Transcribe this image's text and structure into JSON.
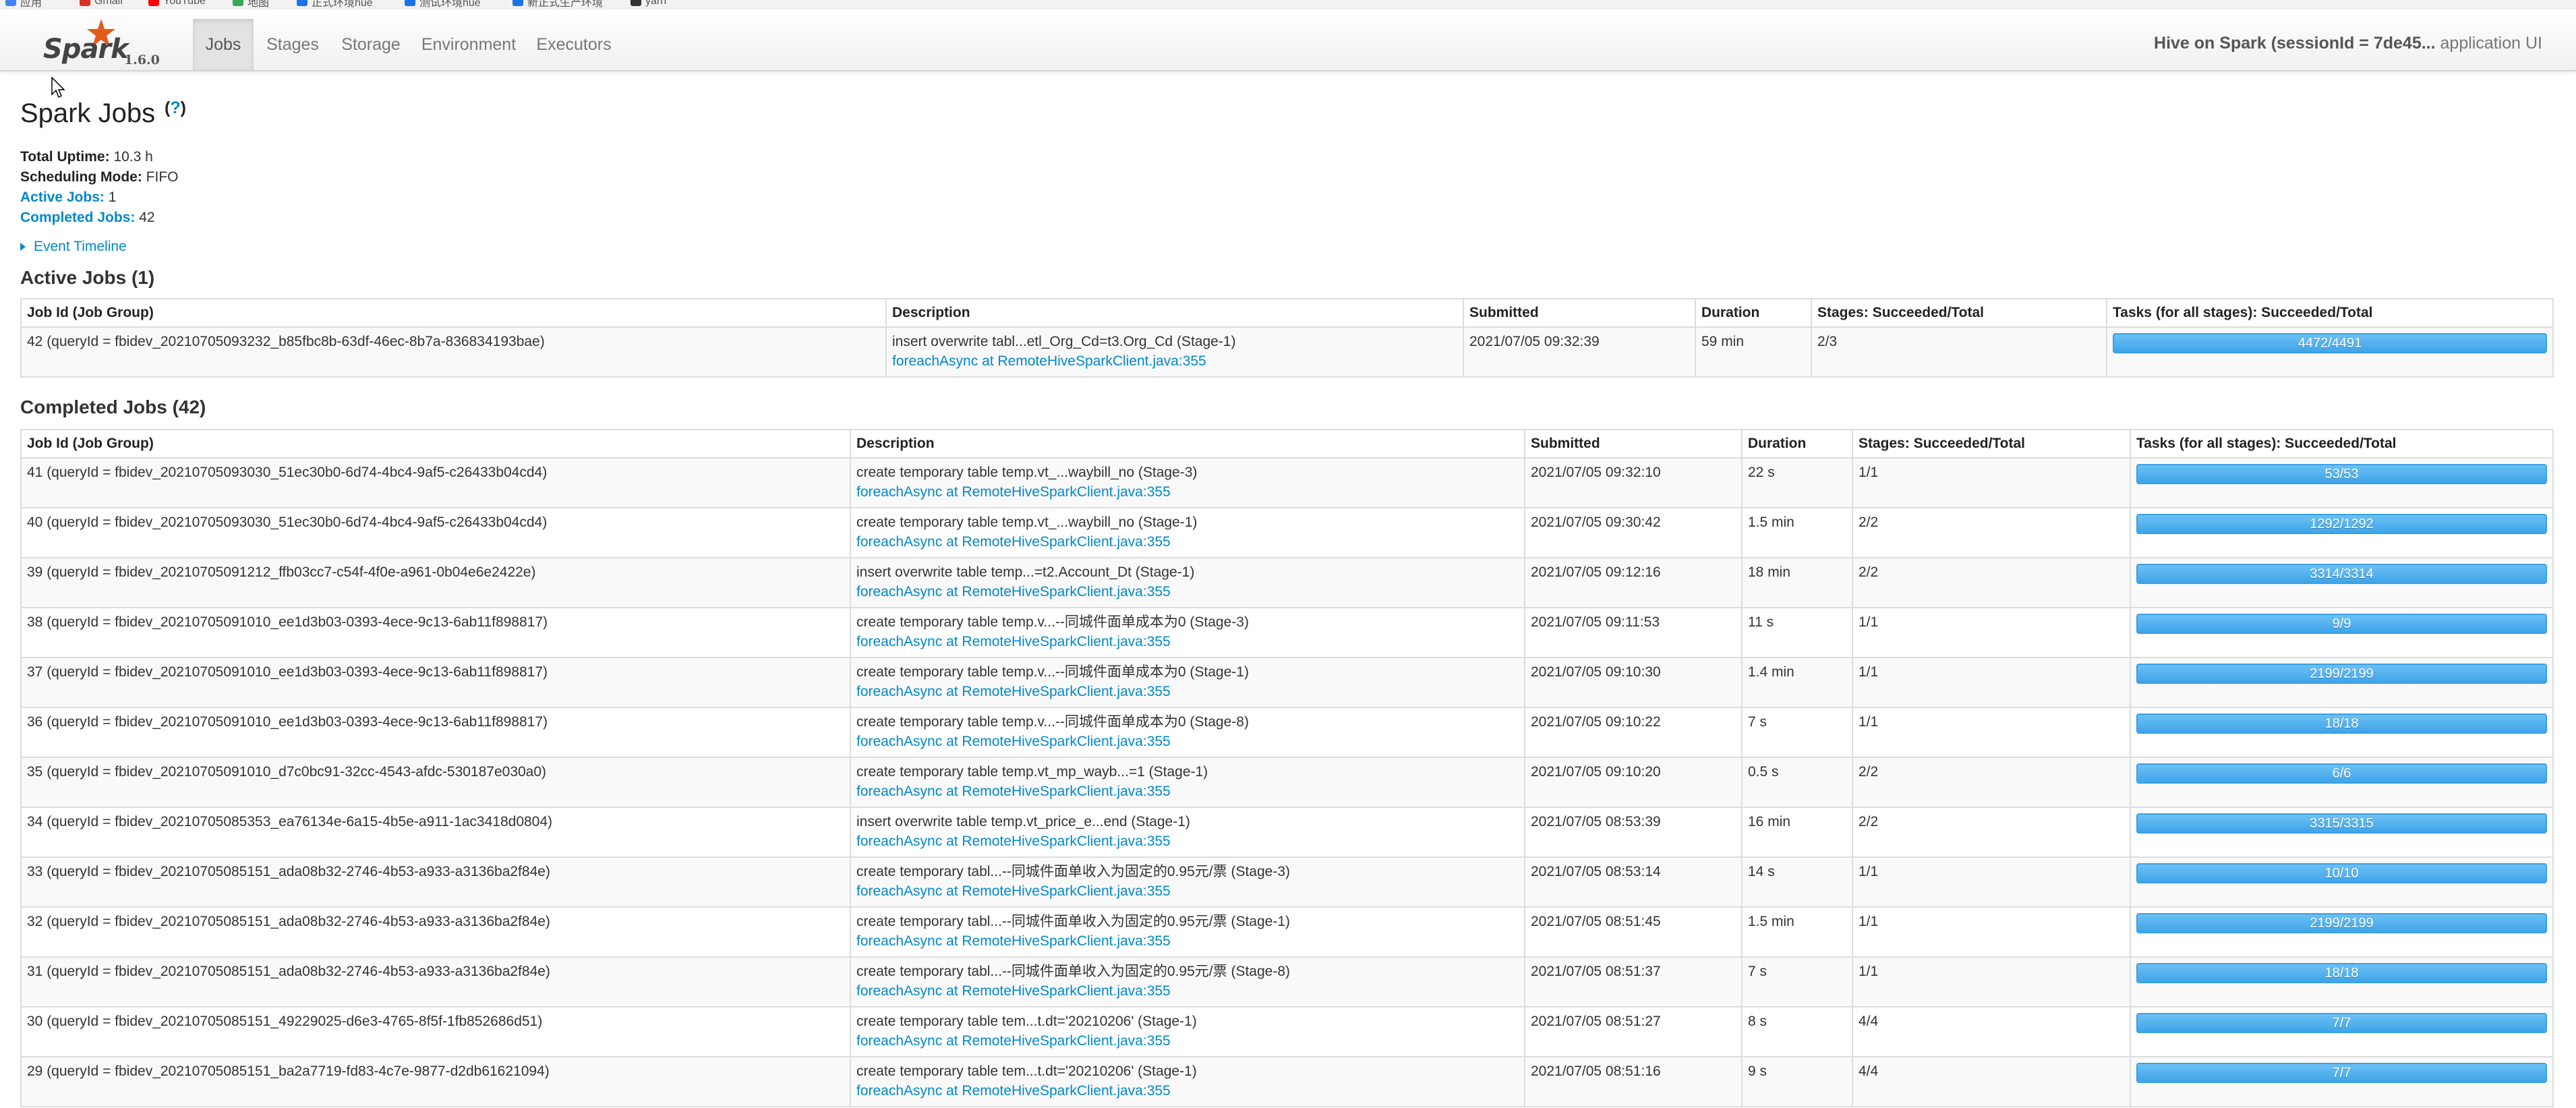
{
  "bookmarks": [
    {
      "label": "应用",
      "icon": "apps-grid-icon",
      "color": "#4285f4"
    },
    {
      "label": "Gmail",
      "icon": "gmail-icon",
      "color": "#d93025"
    },
    {
      "label": "YouTube",
      "icon": "youtube-icon",
      "color": "#ff0000"
    },
    {
      "label": "地图",
      "icon": "maps-icon",
      "color": "#34a853"
    },
    {
      "label": "正式环境hue",
      "icon": "hue-icon",
      "color": "#1a73e8"
    },
    {
      "label": "测试环境hue",
      "icon": "hue-icon",
      "color": "#1a73e8"
    },
    {
      "label": "新正式生产环境",
      "icon": "hue-icon",
      "color": "#1a73e8"
    },
    {
      "label": "yarn",
      "icon": "yarn-icon",
      "color": "#333333"
    }
  ],
  "navbar": {
    "brand": "Spark",
    "version": "1.6.0",
    "tabs": [
      "Jobs",
      "Stages",
      "Storage",
      "Environment",
      "Executors"
    ],
    "active_tab": "Jobs",
    "app_title_bold": "Hive on Spark (sessionId = 7de45...",
    "app_title_rest": " application UI"
  },
  "page": {
    "title": "Spark Jobs",
    "help": "?",
    "summary": {
      "uptime_label": "Total Uptime:",
      "uptime_value": " 10.3 h",
      "sched_label": "Scheduling Mode:",
      "sched_value": " FIFO",
      "active_label": "Active Jobs:",
      "active_value": " 1",
      "completed_label": "Completed Jobs:",
      "completed_value": " 42"
    },
    "event_timeline": "Event Timeline"
  },
  "active_jobs": {
    "heading": "Active Jobs (1)",
    "columns": [
      "Job Id (Job Group)",
      "Description",
      "Submitted",
      "Duration",
      "Stages: Succeeded/Total",
      "Tasks (for all stages): Succeeded/Total"
    ],
    "rows": [
      {
        "id": "42 (queryId = fbidev_20210705093232_b85fbc8b-63df-46ec-8b7a-836834193bae)",
        "desc": "insert overwrite tabl...etl_Org_Cd=t3.Org_Cd (Stage-1)",
        "link": "foreachAsync at RemoteHiveSparkClient.java:355",
        "submitted": "2021/07/05 09:32:39",
        "duration": "59 min",
        "stages": "2/3",
        "tasks": "4472/4491",
        "progress": 0.9958
      }
    ]
  },
  "completed_jobs": {
    "heading": "Completed Jobs (42)",
    "columns": [
      "Job Id (Job Group)",
      "Description",
      "Submitted",
      "Duration",
      "Stages: Succeeded/Total",
      "Tasks (for all stages): Succeeded/Total"
    ],
    "rows": [
      {
        "id": "41 (queryId = fbidev_20210705093030_51ec30b0-6d74-4bc4-9af5-c26433b04cd4)",
        "desc": "create temporary table temp.vt_...waybill_no (Stage-3)",
        "link": "foreachAsync at RemoteHiveSparkClient.java:355",
        "submitted": "2021/07/05 09:32:10",
        "duration": "22 s",
        "stages": "1/1",
        "tasks": "53/53",
        "progress": 1
      },
      {
        "id": "40 (queryId = fbidev_20210705093030_51ec30b0-6d74-4bc4-9af5-c26433b04cd4)",
        "desc": "create temporary table temp.vt_...waybill_no (Stage-1)",
        "link": "foreachAsync at RemoteHiveSparkClient.java:355",
        "submitted": "2021/07/05 09:30:42",
        "duration": "1.5 min",
        "stages": "2/2",
        "tasks": "1292/1292",
        "progress": 1
      },
      {
        "id": "39 (queryId = fbidev_20210705091212_ffb03cc7-c54f-4f0e-a961-0b04e6e2422e)",
        "desc": "insert overwrite table temp...=t2.Account_Dt (Stage-1)",
        "link": "foreachAsync at RemoteHiveSparkClient.java:355",
        "submitted": "2021/07/05 09:12:16",
        "duration": "18 min",
        "stages": "2/2",
        "tasks": "3314/3314",
        "progress": 1
      },
      {
        "id": "38 (queryId = fbidev_20210705091010_ee1d3b03-0393-4ece-9c13-6ab11f898817)",
        "desc": "create temporary table temp.v...--同城件面单成本为0 (Stage-3)",
        "link": "foreachAsync at RemoteHiveSparkClient.java:355",
        "submitted": "2021/07/05 09:11:53",
        "duration": "11 s",
        "stages": "1/1",
        "tasks": "9/9",
        "progress": 1
      },
      {
        "id": "37 (queryId = fbidev_20210705091010_ee1d3b03-0393-4ece-9c13-6ab11f898817)",
        "desc": "create temporary table temp.v...--同城件面单成本为0 (Stage-1)",
        "link": "foreachAsync at RemoteHiveSparkClient.java:355",
        "submitted": "2021/07/05 09:10:30",
        "duration": "1.4 min",
        "stages": "1/1",
        "tasks": "2199/2199",
        "progress": 1
      },
      {
        "id": "36 (queryId = fbidev_20210705091010_ee1d3b03-0393-4ece-9c13-6ab11f898817)",
        "desc": "create temporary table temp.v...--同城件面单成本为0 (Stage-8)",
        "link": "foreachAsync at RemoteHiveSparkClient.java:355",
        "submitted": "2021/07/05 09:10:22",
        "duration": "7 s",
        "stages": "1/1",
        "tasks": "18/18",
        "progress": 1
      },
      {
        "id": "35 (queryId = fbidev_20210705091010_d7c0bc91-32cc-4543-afdc-530187e030a0)",
        "desc": "create temporary table temp.vt_mp_wayb...=1 (Stage-1)",
        "link": "foreachAsync at RemoteHiveSparkClient.java:355",
        "submitted": "2021/07/05 09:10:20",
        "duration": "0.5 s",
        "stages": "2/2",
        "tasks": "6/6",
        "progress": 1
      },
      {
        "id": "34 (queryId = fbidev_20210705085353_ea76134e-6a15-4b5e-a911-1ac3418d0804)",
        "desc": "insert overwrite table temp.vt_price_e...end (Stage-1)",
        "link": "foreachAsync at RemoteHiveSparkClient.java:355",
        "submitted": "2021/07/05 08:53:39",
        "duration": "16 min",
        "stages": "2/2",
        "tasks": "3315/3315",
        "progress": 1
      },
      {
        "id": "33 (queryId = fbidev_20210705085151_ada08b32-2746-4b53-a933-a3136ba2f84e)",
        "desc": "create temporary tabl...--同城件面单收入为固定的0.95元/票 (Stage-3)",
        "link": "foreachAsync at RemoteHiveSparkClient.java:355",
        "submitted": "2021/07/05 08:53:14",
        "duration": "14 s",
        "stages": "1/1",
        "tasks": "10/10",
        "progress": 1
      },
      {
        "id": "32 (queryId = fbidev_20210705085151_ada08b32-2746-4b53-a933-a3136ba2f84e)",
        "desc": "create temporary tabl...--同城件面单收入为固定的0.95元/票 (Stage-1)",
        "link": "foreachAsync at RemoteHiveSparkClient.java:355",
        "submitted": "2021/07/05 08:51:45",
        "duration": "1.5 min",
        "stages": "1/1",
        "tasks": "2199/2199",
        "progress": 1
      },
      {
        "id": "31 (queryId = fbidev_20210705085151_ada08b32-2746-4b53-a933-a3136ba2f84e)",
        "desc": "create temporary tabl...--同城件面单收入为固定的0.95元/票 (Stage-8)",
        "link": "foreachAsync at RemoteHiveSparkClient.java:355",
        "submitted": "2021/07/05 08:51:37",
        "duration": "7 s",
        "stages": "1/1",
        "tasks": "18/18",
        "progress": 1
      },
      {
        "id": "30 (queryId = fbidev_20210705085151_49229025-d6e3-4765-8f5f-1fb852686d51)",
        "desc": "create temporary table tem...t.dt='20210206' (Stage-1)",
        "link": "foreachAsync at RemoteHiveSparkClient.java:355",
        "submitted": "2021/07/05 08:51:27",
        "duration": "8 s",
        "stages": "4/4",
        "tasks": "7/7",
        "progress": 1
      },
      {
        "id": "29 (queryId = fbidev_20210705085151_ba2a7719-fd83-4c7e-9877-d2db61621094)",
        "desc": "create temporary table tem...t.dt='20210206' (Stage-1)",
        "link": "foreachAsync at RemoteHiveSparkClient.java:355",
        "submitted": "2021/07/05 08:51:16",
        "duration": "9 s",
        "stages": "4/4",
        "tasks": "7/7",
        "progress": 1
      }
    ]
  }
}
